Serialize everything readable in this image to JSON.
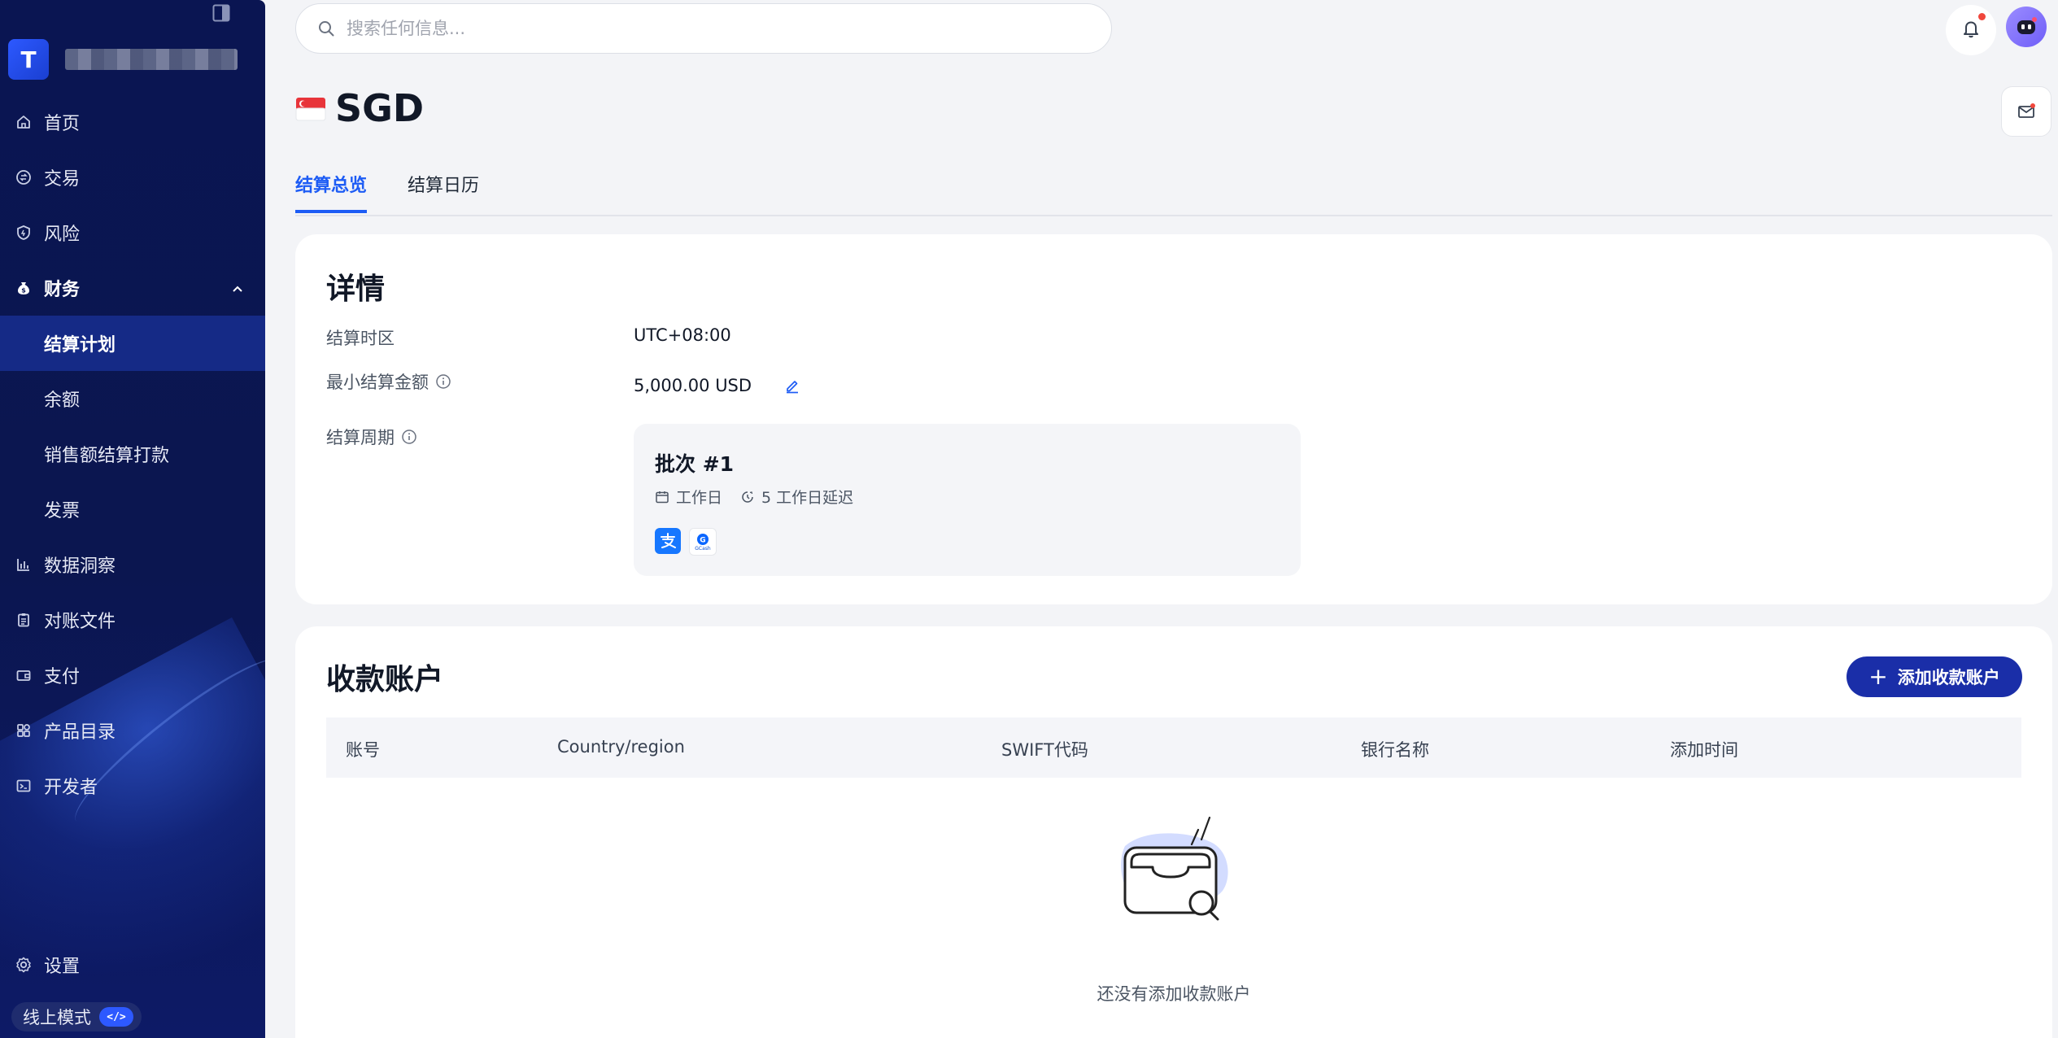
{
  "sidebar": {
    "brand_initial": "T",
    "items": [
      {
        "label": "首页",
        "icon": "home-icon"
      },
      {
        "label": "交易",
        "icon": "transaction-icon"
      },
      {
        "label": "风险",
        "icon": "shield-icon"
      },
      {
        "label": "财务",
        "icon": "money-bag-icon"
      }
    ],
    "finance_sub": [
      {
        "label": "结算计划",
        "active": true
      },
      {
        "label": "余额"
      },
      {
        "label": "销售额结算打款"
      },
      {
        "label": "发票"
      }
    ],
    "items_after": [
      {
        "label": "数据洞察",
        "icon": "bar-chart-icon"
      },
      {
        "label": "对账文件",
        "icon": "clipboard-icon"
      },
      {
        "label": "支付",
        "icon": "wallet-icon"
      },
      {
        "label": "产品目录",
        "icon": "grid-icon"
      },
      {
        "label": "开发者",
        "icon": "terminal-icon"
      }
    ],
    "settings_label": "设置",
    "mode_label": "线上模式",
    "mode_badge": "</>"
  },
  "header": {
    "search_placeholder": "搜索任何信息..."
  },
  "page": {
    "currency": "SGD",
    "tabs": [
      {
        "label": "结算总览",
        "active": true
      },
      {
        "label": "结算日历"
      }
    ]
  },
  "details": {
    "title": "详情",
    "timezone_label": "结算时区",
    "timezone_value": "UTC+08:00",
    "min_amount_label": "最小结算金额",
    "min_amount_value": "5,000.00 USD",
    "period_label": "结算周期",
    "batch": {
      "title": "批次 #1",
      "day_type": "工作日",
      "delay": "5 工作日延迟",
      "methods": [
        "alipay-icon",
        "gcash-icon"
      ],
      "gcash_text": "GCash"
    }
  },
  "accounts": {
    "title": "收款账户",
    "add_button": "添加收款账户",
    "columns": [
      "账号",
      "Country/region",
      "SWIFT代码",
      "银行名称",
      "添加时间"
    ],
    "empty_text": "还没有添加收款账户"
  },
  "colors": {
    "sidebar_bg": "#0a1552",
    "accent": "#1d5cf5",
    "primary_button": "#1a2ea8",
    "notification_dot": "#f0473c"
  }
}
